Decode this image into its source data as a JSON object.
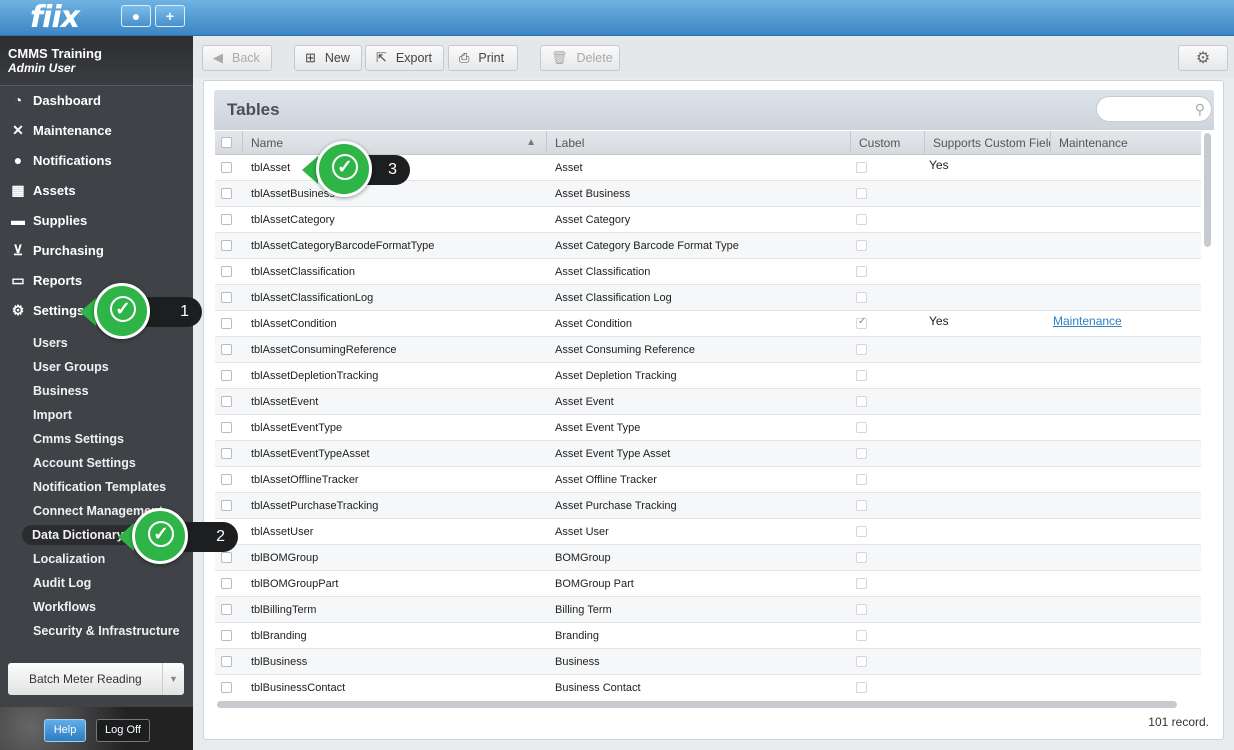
{
  "app": {
    "logo": "fiix",
    "user_btn": "👤",
    "add_btn": "+"
  },
  "sidebar": {
    "org_name": "CMMS Training",
    "org_user": "Admin User",
    "nav": [
      {
        "label": "Dashboard",
        "icon": "dashboard-icon"
      },
      {
        "label": "Maintenance",
        "icon": "tools-icon"
      },
      {
        "label": "Notifications",
        "icon": "chat-bubble-icon"
      },
      {
        "label": "Assets",
        "icon": "boxes-icon"
      },
      {
        "label": "Supplies",
        "icon": "truck-icon"
      },
      {
        "label": "Purchasing",
        "icon": "cart-icon"
      },
      {
        "label": "Reports",
        "icon": "chart-icon"
      },
      {
        "label": "Settings",
        "icon": "gear-icon"
      }
    ],
    "settings_items": [
      "Users",
      "User Groups",
      "Business",
      "Import",
      "Cmms Settings",
      "Account Settings",
      "Notification Templates",
      "Connect Management",
      "Data Dictionary",
      "Localization",
      "Audit Log",
      "Workflows",
      "Security & Infrastructure"
    ],
    "active_item": "Data Dictionary",
    "batch_button": "Batch Meter Reading",
    "help": "Help",
    "logoff": "Log Off"
  },
  "toolbar": {
    "back": "Back",
    "new": "New",
    "export": "Export",
    "print": "Print",
    "delete": "Delete"
  },
  "panel": {
    "title": "Tables",
    "search_placeholder": "",
    "columns": [
      "Name",
      "Label",
      "Custom",
      "Supports Custom Fields",
      "Maintenance"
    ],
    "sort_column": "Name",
    "rows": [
      {
        "name": "tblAsset",
        "label": "Asset",
        "custom": false,
        "supports": "Yes",
        "maintenance": ""
      },
      {
        "name": "tblAssetBusiness",
        "label": "Asset Business",
        "custom": false,
        "supports": "",
        "maintenance": ""
      },
      {
        "name": "tblAssetCategory",
        "label": "Asset Category",
        "custom": false,
        "supports": "",
        "maintenance": ""
      },
      {
        "name": "tblAssetCategoryBarcodeFormatType",
        "label": "Asset Category Barcode Format Type",
        "custom": false,
        "supports": "",
        "maintenance": ""
      },
      {
        "name": "tblAssetClassification",
        "label": "Asset Classification",
        "custom": false,
        "supports": "",
        "maintenance": ""
      },
      {
        "name": "tblAssetClassificationLog",
        "label": "Asset Classification Log",
        "custom": false,
        "supports": "",
        "maintenance": ""
      },
      {
        "name": "tblAssetCondition",
        "label": "Asset Condition",
        "custom": true,
        "supports": "Yes",
        "maintenance": "Maintenance"
      },
      {
        "name": "tblAssetConsumingReference",
        "label": "Asset Consuming Reference",
        "custom": false,
        "supports": "",
        "maintenance": ""
      },
      {
        "name": "tblAssetDepletionTracking",
        "label": "Asset Depletion Tracking",
        "custom": false,
        "supports": "",
        "maintenance": ""
      },
      {
        "name": "tblAssetEvent",
        "label": "Asset Event",
        "custom": false,
        "supports": "",
        "maintenance": ""
      },
      {
        "name": "tblAssetEventType",
        "label": "Asset Event Type",
        "custom": false,
        "supports": "",
        "maintenance": ""
      },
      {
        "name": "tblAssetEventTypeAsset",
        "label": "Asset Event Type Asset",
        "custom": false,
        "supports": "",
        "maintenance": ""
      },
      {
        "name": "tblAssetOfflineTracker",
        "label": "Asset Offline Tracker",
        "custom": false,
        "supports": "",
        "maintenance": ""
      },
      {
        "name": "tblAssetPurchaseTracking",
        "label": "Asset Purchase Tracking",
        "custom": false,
        "supports": "",
        "maintenance": ""
      },
      {
        "name": "tblAssetUser",
        "label": "Asset User",
        "custom": false,
        "supports": "",
        "maintenance": ""
      },
      {
        "name": "tblBOMGroup",
        "label": "BOMGroup",
        "custom": false,
        "supports": "",
        "maintenance": ""
      },
      {
        "name": "tblBOMGroupPart",
        "label": "BOMGroup Part",
        "custom": false,
        "supports": "",
        "maintenance": ""
      },
      {
        "name": "tblBillingTerm",
        "label": "Billing Term",
        "custom": false,
        "supports": "",
        "maintenance": ""
      },
      {
        "name": "tblBranding",
        "label": "Branding",
        "custom": false,
        "supports": "",
        "maintenance": ""
      },
      {
        "name": "tblBusiness",
        "label": "Business",
        "custom": false,
        "supports": "",
        "maintenance": ""
      },
      {
        "name": "tblBusinessContact",
        "label": "Business Contact",
        "custom": false,
        "supports": "",
        "maintenance": ""
      }
    ],
    "record_count": "101 record."
  },
  "callouts": [
    {
      "number": "1",
      "target": "Settings"
    },
    {
      "number": "2",
      "target": "Data Dictionary"
    },
    {
      "number": "3",
      "target": "tblAsset"
    }
  ],
  "colors": {
    "accent_blue": "#3c86c4",
    "sidebar_bg": "#3f4246",
    "callout_green": "#2fb447",
    "link": "#2f7fc1"
  }
}
